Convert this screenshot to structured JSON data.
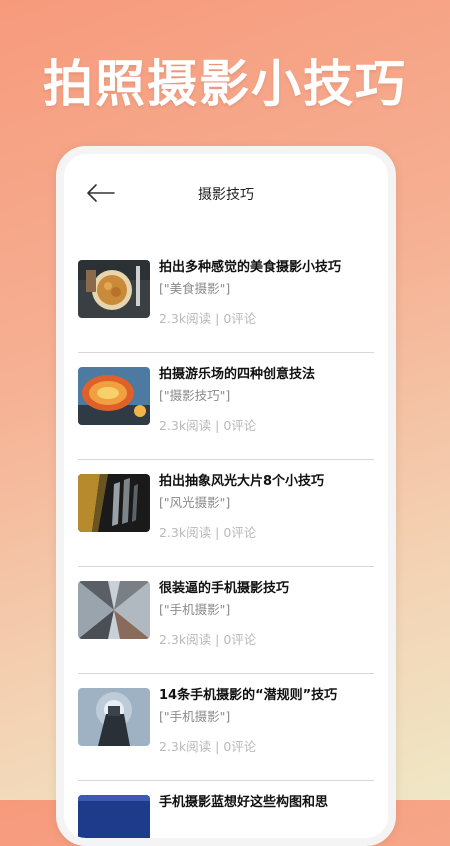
{
  "promo": {
    "title": "拍照摄影小技巧"
  },
  "header": {
    "title": "摄影技巧",
    "back_icon": "arrow-left-icon"
  },
  "articles": [
    {
      "title": "拍出多种感觉的美食摄影小技巧",
      "tag": "[\"美食摄影\"]",
      "reads": "2.3k阅读",
      "sep": "|",
      "comments": "0评论"
    },
    {
      "title": "拍摄游乐场的四种创意技法",
      "tag": "[\"摄影技巧\"]",
      "reads": "2.3k阅读",
      "sep": "|",
      "comments": "0评论"
    },
    {
      "title": "拍出抽象风光大片8个小技巧",
      "tag": "[\"风光摄影\"]",
      "reads": "2.3k阅读",
      "sep": "|",
      "comments": "0评论"
    },
    {
      "title": "很装逼的手机摄影技巧",
      "tag": "[\"手机摄影\"]",
      "reads": "2.3k阅读",
      "sep": "|",
      "comments": "0评论"
    },
    {
      "title": "14条手机摄影的“潜规则”技巧",
      "tag": "[\"手机摄影\"]",
      "reads": "2.3k阅读",
      "sep": "|",
      "comments": "0评论"
    },
    {
      "title": "手机摄影蓝想好这些构图和思",
      "tag": "",
      "reads": "",
      "sep": "",
      "comments": ""
    }
  ]
}
